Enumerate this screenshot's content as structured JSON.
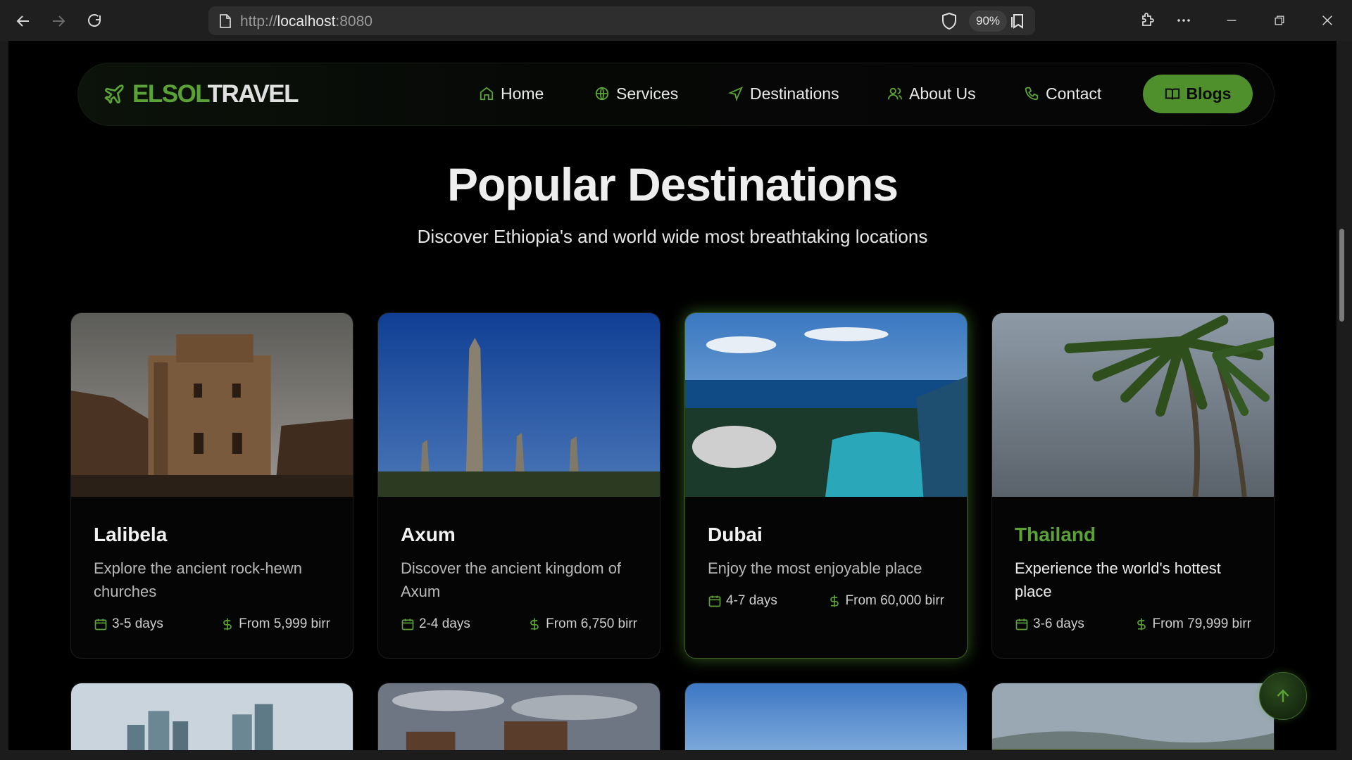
{
  "browser": {
    "url_prefix": "http://",
    "url_host": "localhost",
    "url_port": ":8080",
    "zoom": "90%"
  },
  "site": {
    "logo_part1": "ELSOL",
    "logo_part2": "TRAVEL",
    "nav": {
      "home": "Home",
      "services": "Services",
      "destinations": "Destinations",
      "about": "About Us",
      "contact": "Contact",
      "blogs": "Blogs"
    }
  },
  "section": {
    "title": "Popular Destinations",
    "subtitle": "Discover Ethiopia's and world wide most breathtaking locations"
  },
  "destinations": [
    {
      "name": "Lalibela",
      "desc": "Explore the ancient rock-hewn churches",
      "days": "3-5 days",
      "price": "From 5,999 birr"
    },
    {
      "name": "Axum",
      "desc": "Discover the ancient kingdom of Axum",
      "days": "2-4 days",
      "price": "From 6,750 birr"
    },
    {
      "name": "Dubai",
      "desc": "Enjoy the most enjoyable place",
      "days": "4-7 days",
      "price": "From 60,000 birr"
    },
    {
      "name": "Thailand",
      "desc": "Experience the world's hottest place",
      "days": "3-6 days",
      "price": "From 79,999 birr"
    }
  ],
  "colors": {
    "accent": "#5ba236",
    "button": "#4f8f2c",
    "background": "#000000"
  }
}
